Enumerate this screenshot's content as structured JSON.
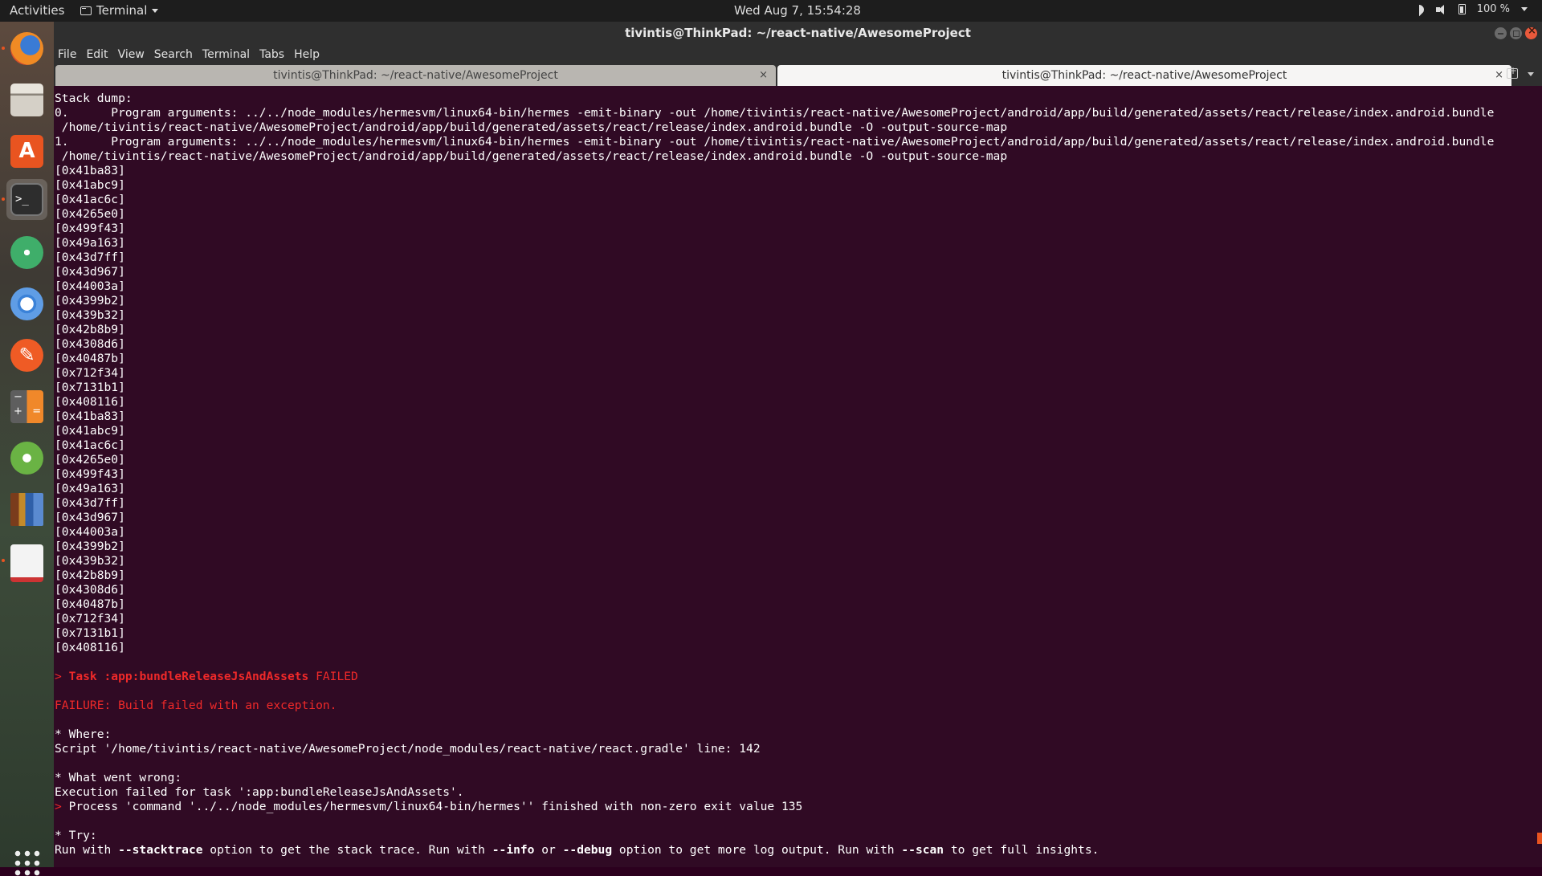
{
  "topbar": {
    "activities": "Activities",
    "app_menu": "Terminal",
    "clock": "Wed Aug  7, 15:54:28",
    "battery": "100 %"
  },
  "window": {
    "title": "tivintis@ThinkPad: ~/react-native/AwesomeProject"
  },
  "menu": [
    "File",
    "Edit",
    "View",
    "Search",
    "Terminal",
    "Tabs",
    "Help"
  ],
  "tabs": [
    {
      "label": "tivintis@ThinkPad: ~/react-native/AwesomeProject",
      "active": false
    },
    {
      "label": "tivintis@ThinkPad: ~/react-native/AwesomeProject",
      "active": true
    }
  ],
  "dock": {
    "apps": [
      "firefox",
      "files",
      "software-center",
      "terminal",
      "atom",
      "chromium",
      "postman",
      "calculator",
      "android-studio",
      "calibre",
      "document-viewer"
    ]
  },
  "terminal": {
    "lines": [
      {
        "t": "Stack dump:"
      },
      {
        "t": "0.      Program arguments: ../../node_modules/hermesvm/linux64-bin/hermes -emit-binary -out /home/tivintis/react-native/AwesomeProject/android/app/build/generated/assets/react/release/index.android.bundle"
      },
      {
        "t": " /home/tivintis/react-native/AwesomeProject/android/app/build/generated/assets/react/release/index.android.bundle -O -output-source-map"
      },
      {
        "t": "1.      Program arguments: ../../node_modules/hermesvm/linux64-bin/hermes -emit-binary -out /home/tivintis/react-native/AwesomeProject/android/app/build/generated/assets/react/release/index.android.bundle"
      },
      {
        "t": " /home/tivintis/react-native/AwesomeProject/android/app/build/generated/assets/react/release/index.android.bundle -O -output-source-map"
      },
      {
        "t": "[0x41ba83]"
      },
      {
        "t": "[0x41abc9]"
      },
      {
        "t": "[0x41ac6c]"
      },
      {
        "t": "[0x4265e0]"
      },
      {
        "t": "[0x499f43]"
      },
      {
        "t": "[0x49a163]"
      },
      {
        "t": "[0x43d7ff]"
      },
      {
        "t": "[0x43d967]"
      },
      {
        "t": "[0x44003a]"
      },
      {
        "t": "[0x4399b2]"
      },
      {
        "t": "[0x439b32]"
      },
      {
        "t": "[0x42b8b9]"
      },
      {
        "t": "[0x4308d6]"
      },
      {
        "t": "[0x40487b]"
      },
      {
        "t": "[0x712f34]"
      },
      {
        "t": "[0x7131b1]"
      },
      {
        "t": "[0x408116]"
      },
      {
        "t": "[0x41ba83]"
      },
      {
        "t": "[0x41abc9]"
      },
      {
        "t": "[0x41ac6c]"
      },
      {
        "t": "[0x4265e0]"
      },
      {
        "t": "[0x499f43]"
      },
      {
        "t": "[0x49a163]"
      },
      {
        "t": "[0x43d7ff]"
      },
      {
        "t": "[0x43d967]"
      },
      {
        "t": "[0x44003a]"
      },
      {
        "t": "[0x4399b2]"
      },
      {
        "t": "[0x439b32]"
      },
      {
        "t": "[0x42b8b9]"
      },
      {
        "t": "[0x4308d6]"
      },
      {
        "t": "[0x40487b]"
      },
      {
        "t": "[0x712f34]"
      },
      {
        "t": "[0x7131b1]"
      },
      {
        "t": "[0x408116]"
      },
      {
        "t": ""
      },
      {
        "segs": [
          {
            "t": "> ",
            "c": "red"
          },
          {
            "t": "Task :app:bundleReleaseJsAndAssets",
            "c": "redb"
          },
          {
            "t": " FAILED",
            "c": "red"
          }
        ]
      },
      {
        "t": ""
      },
      {
        "segs": [
          {
            "t": "FAILURE: Build failed with an exception.",
            "c": "red"
          }
        ]
      },
      {
        "t": ""
      },
      {
        "t": "* Where:"
      },
      {
        "t": "Script '/home/tivintis/react-native/AwesomeProject/node_modules/react-native/react.gradle' line: 142"
      },
      {
        "t": ""
      },
      {
        "t": "* What went wrong:"
      },
      {
        "t": "Execution failed for task ':app:bundleReleaseJsAndAssets'."
      },
      {
        "segs": [
          {
            "t": "> ",
            "c": "red"
          },
          {
            "t": "Process 'command '../../node_modules/hermesvm/linux64-bin/hermes'' finished with non-zero exit value 135",
            "c": ""
          }
        ]
      },
      {
        "t": ""
      },
      {
        "t": "* Try:"
      },
      {
        "segs": [
          {
            "t": "Run with ",
            "c": ""
          },
          {
            "t": "--stacktrace",
            "c": "b"
          },
          {
            "t": " option to get the stack trace. Run with ",
            "c": ""
          },
          {
            "t": "--info",
            "c": "b"
          },
          {
            "t": " or ",
            "c": ""
          },
          {
            "t": "--debug",
            "c": "b"
          },
          {
            "t": " option to get more log output. Run with ",
            "c": ""
          },
          {
            "t": "--scan",
            "c": "b"
          },
          {
            "t": " to get full insights.",
            "c": ""
          }
        ]
      }
    ]
  }
}
